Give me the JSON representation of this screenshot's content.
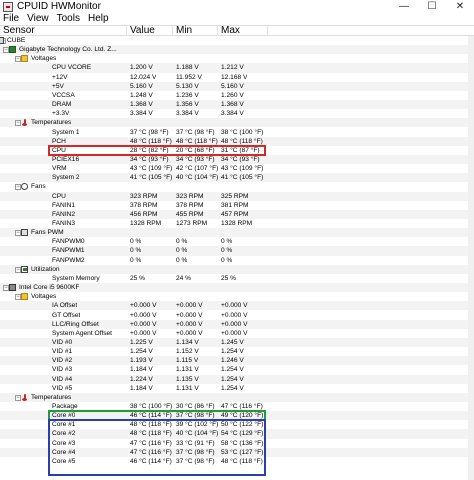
{
  "window": {
    "title": "CPUID HWMonitor",
    "controls": {
      "minimize": "—",
      "maximize": "☐",
      "close": "✕"
    }
  },
  "menu": [
    "File",
    "View",
    "Tools",
    "Help"
  ],
  "columns": {
    "sensor": "Sensor",
    "value": "Value",
    "min": "Min",
    "max": "Max"
  },
  "rows": [
    {
      "level": 0,
      "type": "node",
      "icon": "computer-icon",
      "label": "CUBE"
    },
    {
      "level": 1,
      "type": "node",
      "icon": "motherboard-icon",
      "label": "Gigabyte Technology Co. Ltd. Z..."
    },
    {
      "level": 2,
      "type": "group",
      "icon": "voltage-icon",
      "label": "Voltages"
    },
    {
      "level": 3,
      "type": "sensor",
      "label": "CPU VCORE",
      "value": "1.200 V",
      "min": "1.188 V",
      "max": "1.212 V"
    },
    {
      "level": 3,
      "type": "sensor",
      "label": "+12V",
      "value": "12.024 V",
      "min": "11.952 V",
      "max": "12.168 V"
    },
    {
      "level": 3,
      "type": "sensor",
      "label": "+5V",
      "value": "5.160 V",
      "min": "5.130 V",
      "max": "5.160 V"
    },
    {
      "level": 3,
      "type": "sensor",
      "label": "VCCSA",
      "value": "1.248 V",
      "min": "1.236 V",
      "max": "1.260 V"
    },
    {
      "level": 3,
      "type": "sensor",
      "label": "DRAM",
      "value": "1.368 V",
      "min": "1.356 V",
      "max": "1.368 V"
    },
    {
      "level": 3,
      "type": "sensor",
      "label": "+3.3V",
      "value": "3.384 V",
      "min": "3.384 V",
      "max": "3.384 V"
    },
    {
      "level": 2,
      "type": "group",
      "icon": "thermometer-icon",
      "label": "Temperatures"
    },
    {
      "level": 3,
      "type": "sensor",
      "label": "System 1",
      "value": "37 °C  (98 °F)",
      "min": "37 °C  (98 °F)",
      "max": "38 °C  (100 °F)"
    },
    {
      "level": 3,
      "type": "sensor",
      "label": "PCH",
      "value": "48 °C  (118 °F)",
      "min": "48 °C  (118 °F)",
      "max": "48 °C  (118 °F)"
    },
    {
      "level": 3,
      "type": "sensor",
      "label": "CPU",
      "value": "28 °C  (82 °F)",
      "min": "20 °C  (68 °F)",
      "max": "31 °C  (87 °F)"
    },
    {
      "level": 3,
      "type": "sensor",
      "label": "PCIEX16",
      "value": "34 °C  (93 °F)",
      "min": "34 °C  (93 °F)",
      "max": "34 °C  (93 °F)"
    },
    {
      "level": 3,
      "type": "sensor",
      "label": "VRM",
      "value": "43 °C  (109 °F)",
      "min": "42 °C  (107 °F)",
      "max": "43 °C  (109 °F)"
    },
    {
      "level": 3,
      "type": "sensor",
      "label": "System 2",
      "value": "41 °C  (105 °F)",
      "min": "40 °C  (104 °F)",
      "max": "41 °C  (105 °F)"
    },
    {
      "level": 2,
      "type": "group",
      "icon": "fan-icon",
      "label": "Fans"
    },
    {
      "level": 3,
      "type": "sensor",
      "label": "CPU",
      "value": "323 RPM",
      "min": "323 RPM",
      "max": "325 RPM"
    },
    {
      "level": 3,
      "type": "sensor",
      "label": "FANIN1",
      "value": "378 RPM",
      "min": "378 RPM",
      "max": "381 RPM"
    },
    {
      "level": 3,
      "type": "sensor",
      "label": "FANIN2",
      "value": "456 RPM",
      "min": "455 RPM",
      "max": "457 RPM"
    },
    {
      "level": 3,
      "type": "sensor",
      "label": "FANIN3",
      "value": "1328 RPM",
      "min": "1273 RPM",
      "max": "1328 RPM"
    },
    {
      "level": 2,
      "type": "group",
      "icon": "fan-pwm-icon",
      "label": "Fans PWM"
    },
    {
      "level": 3,
      "type": "sensor",
      "label": "FANPWM0",
      "value": "0 %",
      "min": "0 %",
      "max": "0 %"
    },
    {
      "level": 3,
      "type": "sensor",
      "label": "FANPWM1",
      "value": "0 %",
      "min": "0 %",
      "max": "0 %"
    },
    {
      "level": 3,
      "type": "sensor",
      "label": "FANPWM2",
      "value": "0 %",
      "min": "0 %",
      "max": "0 %"
    },
    {
      "level": 2,
      "type": "group",
      "icon": "utilization-icon",
      "label": "Utilization"
    },
    {
      "level": 3,
      "type": "sensor",
      "label": "System Memory",
      "value": "25 %",
      "min": "24 %",
      "max": "25 %"
    },
    {
      "level": 1,
      "type": "node",
      "icon": "cpu-icon",
      "label": "Intel Core i5 9600KF"
    },
    {
      "level": 2,
      "type": "group",
      "icon": "voltage-icon",
      "label": "Voltages"
    },
    {
      "level": 3,
      "type": "sensor",
      "label": "IA Offset",
      "value": "+0.000 V",
      "min": "+0.000 V",
      "max": "+0.000 V"
    },
    {
      "level": 3,
      "type": "sensor",
      "label": "GT Offset",
      "value": "+0.000 V",
      "min": "+0.000 V",
      "max": "+0.000 V"
    },
    {
      "level": 3,
      "type": "sensor",
      "label": "LLC/Ring Offset",
      "value": "+0.000 V",
      "min": "+0.000 V",
      "max": "+0.000 V"
    },
    {
      "level": 3,
      "type": "sensor",
      "label": "System Agent Offset",
      "value": "+0.000 V",
      "min": "+0.000 V",
      "max": "+0.000 V"
    },
    {
      "level": 3,
      "type": "sensor",
      "label": "VID #0",
      "value": "1.225 V",
      "min": "1.134 V",
      "max": "1.245 V"
    },
    {
      "level": 3,
      "type": "sensor",
      "label": "VID #1",
      "value": "1.254 V",
      "min": "1.152 V",
      "max": "1.254 V"
    },
    {
      "level": 3,
      "type": "sensor",
      "label": "VID #2",
      "value": "1.193 V",
      "min": "1.115 V",
      "max": "1.246 V"
    },
    {
      "level": 3,
      "type": "sensor",
      "label": "VID #3",
      "value": "1.184 V",
      "min": "1.131 V",
      "max": "1.254 V"
    },
    {
      "level": 3,
      "type": "sensor",
      "label": "VID #4",
      "value": "1.224 V",
      "min": "1.135 V",
      "max": "1.254 V"
    },
    {
      "level": 3,
      "type": "sensor",
      "label": "VID #5",
      "value": "1.184 V",
      "min": "1.131 V",
      "max": "1.254 V"
    },
    {
      "level": 2,
      "type": "group",
      "icon": "thermometer-icon",
      "label": "Temperatures"
    },
    {
      "level": 3,
      "type": "sensor",
      "label": "Package",
      "value": "38 °C  (100 °F)",
      "min": "30 °C  (86 °F)",
      "max": "47 °C  (116 °F)"
    },
    {
      "level": 3,
      "type": "sensor",
      "label": "Core #0",
      "value": "46 °C  (114 °F)",
      "min": "37 °C  (98 °F)",
      "max": "49 °C  (120 °F)"
    },
    {
      "level": 3,
      "type": "sensor",
      "label": "Core #1",
      "value": "48 °C  (118 °F)",
      "min": "39 °C  (102 °F)",
      "max": "50 °C  (122 °F)"
    },
    {
      "level": 3,
      "type": "sensor",
      "label": "Core #2",
      "value": "48 °C  (118 °F)",
      "min": "40 °C  (104 °F)",
      "max": "54 °C  (129 °F)"
    },
    {
      "level": 3,
      "type": "sensor",
      "label": "Core #3",
      "value": "47 °C  (116 °F)",
      "min": "33 °C  (91 °F)",
      "max": "58 °C  (136 °F)"
    },
    {
      "level": 3,
      "type": "sensor",
      "label": "Core #4",
      "value": "47 °C  (116 °F)",
      "min": "37 °C  (98 °F)",
      "max": "53 °C  (127 °F)"
    },
    {
      "level": 3,
      "type": "sensor",
      "label": "Core #5",
      "value": "46 °C  (114 °F)",
      "min": "37 °C  (98 °F)",
      "max": "48 °C  (118 °F)"
    }
  ],
  "highlight_colors": {
    "red": "#d62828",
    "green": "#1a9e3a",
    "blue": "#2a3eb1"
  },
  "highlights": [
    {
      "color": "red",
      "rows": [
        12
      ]
    },
    {
      "color": "green",
      "rows": [
        41
      ]
    },
    {
      "color": "blue",
      "rows": [
        42,
        43,
        44,
        45,
        46,
        47
      ]
    }
  ]
}
